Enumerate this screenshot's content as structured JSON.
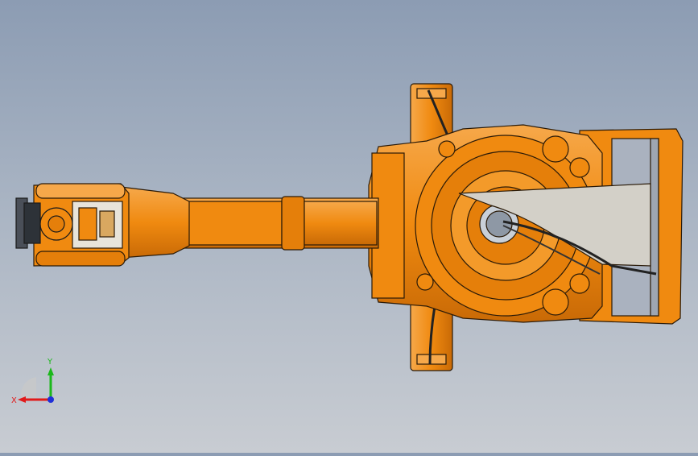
{
  "view": {
    "type": "cad-3d-viewport",
    "model": "industrial-robot-arm",
    "background_top": "#8c9cb3",
    "background_bottom": "#c8ccd2"
  },
  "colors": {
    "robot_orange": "#f08a10",
    "robot_orange_light": "#f6a84a",
    "robot_orange_dark": "#b75c05",
    "outline": "#2a1a08",
    "counterweight_grey": "#d3d0c8",
    "base_glass": "#aab2bf"
  },
  "triad": {
    "x_label": "X",
    "y_label": "Y",
    "x_color": "#e11a1a",
    "y_color": "#1bb81b",
    "z_color": "#1f2fd8"
  }
}
